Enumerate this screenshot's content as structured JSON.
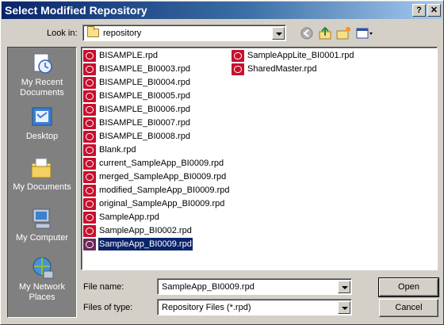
{
  "window": {
    "title": "Select Modified Repository",
    "help_label": "?",
    "close_label": "✕"
  },
  "lookin": {
    "label": "Look in:",
    "value": "repository"
  },
  "toolbar": {
    "icons": [
      "back-icon",
      "up-folder-icon",
      "new-folder-icon",
      "view-menu-icon"
    ]
  },
  "places": [
    {
      "label": "My Recent Documents",
      "icon": "recent-documents-icon"
    },
    {
      "label": "Desktop",
      "icon": "desktop-icon"
    },
    {
      "label": "My Documents",
      "icon": "my-documents-icon"
    },
    {
      "label": "My Computer",
      "icon": "my-computer-icon"
    },
    {
      "label": "My Network Places",
      "icon": "network-places-icon"
    }
  ],
  "files_col1": [
    "BISAMPLE.rpd",
    "BISAMPLE_BI0003.rpd",
    "BISAMPLE_BI0004.rpd",
    "BISAMPLE_BI0005.rpd",
    "BISAMPLE_BI0006.rpd",
    "BISAMPLE_BI0007.rpd",
    "BISAMPLE_BI0008.rpd",
    "Blank.rpd",
    "current_SampleApp_BI0009.rpd",
    "merged_SampleApp_BI0009.rpd",
    "modified_SampleApp_BI0009.rpd",
    "original_SampleApp_BI0009.rpd",
    "SampleApp.rpd",
    "SampleApp_BI0002.rpd",
    "SampleApp_BI0009.rpd"
  ],
  "files_col2": [
    "SampleAppLite_BI0001.rpd",
    "SharedMaster.rpd"
  ],
  "selected_file": "SampleApp_BI0009.rpd",
  "filename": {
    "label": "File name:",
    "value": "SampleApp_BI0009.rpd"
  },
  "filetype": {
    "label": "Files of type:",
    "value": "Repository Files (*.rpd)"
  },
  "buttons": {
    "open": "Open",
    "cancel": "Cancel"
  },
  "colors": {
    "titlebar_start": "#0a246a",
    "titlebar_end": "#a6caf0",
    "file_icon": "#c8102e",
    "selection": "#0a246a"
  }
}
